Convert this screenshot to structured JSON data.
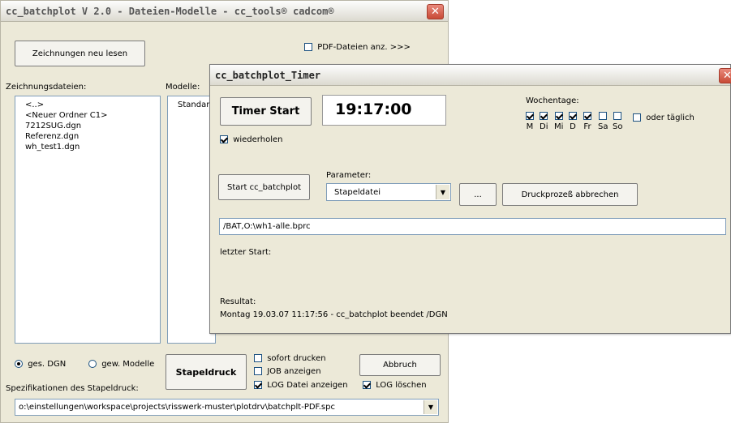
{
  "main_window": {
    "title": "cc_batchplot V 2.0 - Dateien-Modelle - cc_tools® cadcom®",
    "read_drawings_button": "Zeichnungen neu lesen",
    "pdf_checkbox_label": "PDF-Dateien anz. >>>",
    "pdf_checked": false,
    "files_label": "Zeichnungsdateien:",
    "files": [
      "<..>",
      "<Neuer Ordner C1>",
      "7212SUG.dgn",
      "Referenz.dgn",
      "wh_test1.dgn"
    ],
    "models_label": "Modelle:",
    "models": [
      "Standar"
    ],
    "radio_all": "ges. DGN",
    "radio_selected": "gew. Modelle",
    "radio_all_selected": true,
    "batch_print_button": "Stapeldruck",
    "print_now_label": "sofort drucken",
    "print_now_checked": false,
    "show_job_label": "JOB anzeigen",
    "show_job_checked": false,
    "show_log_label": "LOG Datei anzeigen",
    "show_log_checked": true,
    "delete_log_label": "LOG löschen",
    "delete_log_checked": true,
    "cancel_button": "Abbruch",
    "spec_label": "Spezifikationen des Stapeldruck:",
    "spec_value": "o:\\einstellungen\\workspace\\projects\\risswerk-muster\\plotdrv\\batchplt-PDF.spc"
  },
  "timer_window": {
    "title": "cc_batchplot_Timer",
    "timer_start_button": "Timer Start",
    "time_value": "19:17:00",
    "repeat_label": "wiederholen",
    "repeat_checked": true,
    "weekdays_label": "Wochentage:",
    "weekdays": [
      {
        "label": "M",
        "checked": true
      },
      {
        "label": "Di",
        "checked": true
      },
      {
        "label": "Mi",
        "checked": true
      },
      {
        "label": "D",
        "checked": true
      },
      {
        "label": "Fr",
        "checked": true
      },
      {
        "label": "Sa",
        "checked": false
      },
      {
        "label": "So",
        "checked": false
      }
    ],
    "daily_label": "oder täglich",
    "daily_checked": false,
    "start_batchplot_button": "Start cc_batchplot",
    "parameter_label": "Parameter:",
    "parameter_value": "Stapeldatei",
    "browse_button": "...",
    "abort_print_button": "Druckprozeß abbrechen",
    "command_value": "/BAT,O:\\wh1-alle.bprc",
    "last_start_label": "letzter Start:",
    "result_label": "Resultat:",
    "result_value": "Montag 19.03.07 11:17:56 - cc_batchplot beendet /DGN"
  }
}
